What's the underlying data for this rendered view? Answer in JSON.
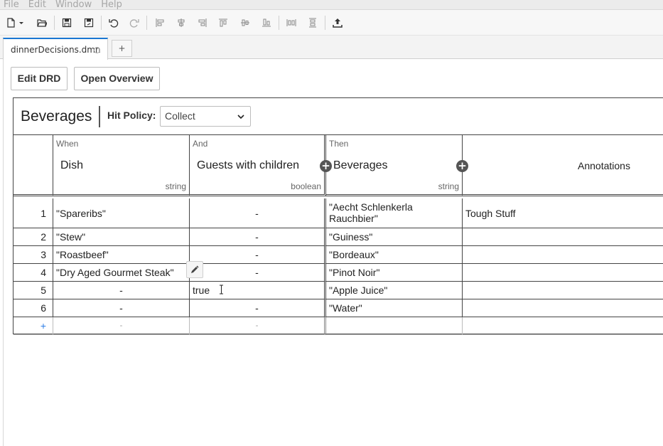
{
  "menu": [
    "File",
    "Edit",
    "Window",
    "Help"
  ],
  "toolbar_icons": [
    "new-file-icon",
    "dropdown-caret-icon",
    "open-folder-icon",
    "save-icon",
    "save-as-icon",
    "undo-icon",
    "redo-icon",
    "align-left-icon",
    "align-center-icon",
    "align-right-icon",
    "align-top-icon",
    "align-middle-icon",
    "align-bottom-icon",
    "distribute-horizontal-icon",
    "distribute-vertical-icon",
    "export-icon"
  ],
  "tabs": [
    {
      "label": "dinnerDecisions.dmn"
    }
  ],
  "tab_add_label": "+",
  "buttons": {
    "edit_drd": "Edit DRD",
    "open_overview": "Open Overview"
  },
  "table": {
    "name": "Beverages",
    "hit_policy_label": "Hit Policy:",
    "hit_policy_value": "Collect",
    "inputs": [
      {
        "clause": "When",
        "label": "Dish",
        "type": "string"
      },
      {
        "clause": "And",
        "label": "Guests with children",
        "type": "boolean"
      }
    ],
    "output": {
      "clause": "Then",
      "label": "Beverages",
      "type": "string"
    },
    "annotations_label": "Annotations",
    "add_clause_symbol": "+",
    "rows": [
      {
        "num": "1",
        "dish": "\"Spareribs\"",
        "guests": "-",
        "beverage": "\"Aecht Schlenkerla Rauchbier\"",
        "annotation": "Tough Stuff"
      },
      {
        "num": "2",
        "dish": "\"Stew\"",
        "guests": "-",
        "beverage": "\"Guiness\"",
        "annotation": ""
      },
      {
        "num": "3",
        "dish": "\"Roastbeef\"",
        "guests": "-",
        "beverage": "\"Bordeaux\"",
        "annotation": ""
      },
      {
        "num": "4",
        "dish": "\"Dry Aged Gourmet Steak\"",
        "guests": "-",
        "beverage": "\"Pinot Noir\"",
        "annotation": ""
      },
      {
        "num": "5",
        "dish": "-",
        "guests": "true",
        "beverage": "\"Apple Juice\"",
        "annotation": ""
      },
      {
        "num": "6",
        "dish": "-",
        "guests": "-",
        "beverage": "\"Water\"",
        "annotation": ""
      }
    ],
    "add_row": {
      "symbol": "+",
      "dish": "-",
      "guests": "-"
    }
  }
}
